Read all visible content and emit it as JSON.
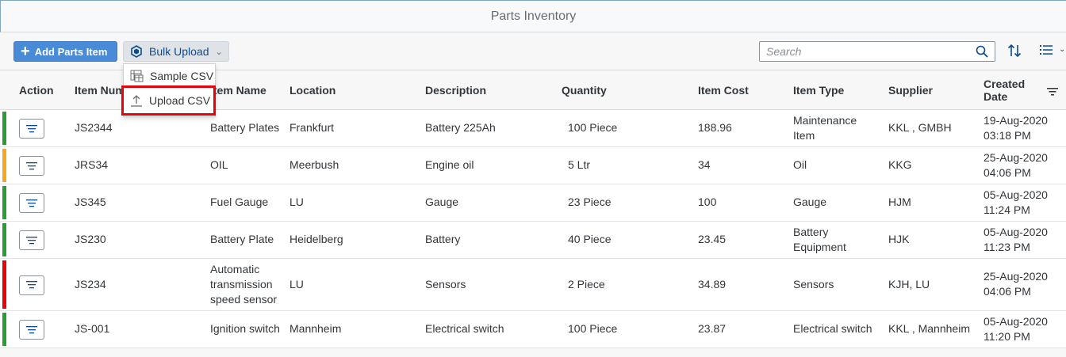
{
  "app": {
    "title": "Parts Inventory"
  },
  "toolbar": {
    "add_label": "Add Parts Item",
    "bulk_label": "Bulk Upload",
    "search_placeholder": "Search"
  },
  "menu": {
    "items": [
      {
        "label": "Sample CSV",
        "icon": "spreadsheet-icon"
      },
      {
        "label": "Upload CSV",
        "icon": "upload-icon"
      }
    ]
  },
  "table": {
    "columns": [
      "Action",
      "Item Num",
      "Item Name",
      "Location",
      "Description",
      "Quantity",
      "Item Cost",
      "Item Type",
      "Supplier",
      "Created Date"
    ],
    "rows": [
      {
        "status_color": "#2b9c33",
        "item_num": "JS2344",
        "item_name": "Battery Plates",
        "location": "Frankfurt",
        "description": "Battery 225Ah",
        "quantity": "100  Piece",
        "cost": "188.96",
        "type": "Maintenance Item",
        "supplier": "KKL , GMBH",
        "date": "19-Aug-2020 03:18 PM"
      },
      {
        "status_color": "#f5a623",
        "item_num": "JRS34",
        "item_name": "OIL",
        "location": "Meerbush",
        "description": "Engine oil",
        "quantity": "5  Ltr",
        "cost": "34",
        "type": "Oil",
        "supplier": "KKG",
        "date": "25-Aug-2020 04:06 PM"
      },
      {
        "status_color": "#2b9c33",
        "item_num": "JS345",
        "item_name": "Fuel Gauge",
        "location": "LU",
        "description": "Gauge",
        "quantity": "23  Piece",
        "cost": "100",
        "type": "Gauge",
        "supplier": "HJM",
        "date": "05-Aug-2020 11:24 PM"
      },
      {
        "status_color": "#2b9c33",
        "item_num": "JS230",
        "item_name": "Battery Plate",
        "location": "Heidelberg",
        "description": "Battery",
        "quantity": "40  Piece",
        "cost": "23.45",
        "type": "Battery Equipment",
        "supplier": "HJK",
        "date": "05-Aug-2020 11:23 PM"
      },
      {
        "status_color": "#e8000b",
        "item_num": "JS234",
        "item_name": "Automatic transmission speed sensor",
        "location": "LU",
        "description": "Sensors",
        "quantity": "2  Piece",
        "cost": "34.89",
        "type": "Sensors",
        "supplier": "KJH, LU",
        "date": "25-Aug-2020 04:06 PM"
      },
      {
        "status_color": "#2b9c33",
        "item_num": "JS-001",
        "item_name": "Ignition switch",
        "location": "Mannheim",
        "description": "Electrical switch",
        "quantity": "100  Piece",
        "cost": "23.87",
        "type": "Electrical switch",
        "supplier": "KKL , Mannheim",
        "date": "05-Aug-2020 11:20 PM"
      }
    ]
  },
  "colors": {
    "accent": "#4a8bd8",
    "highlight": "#e8000b",
    "link": "#0a4a8f"
  }
}
